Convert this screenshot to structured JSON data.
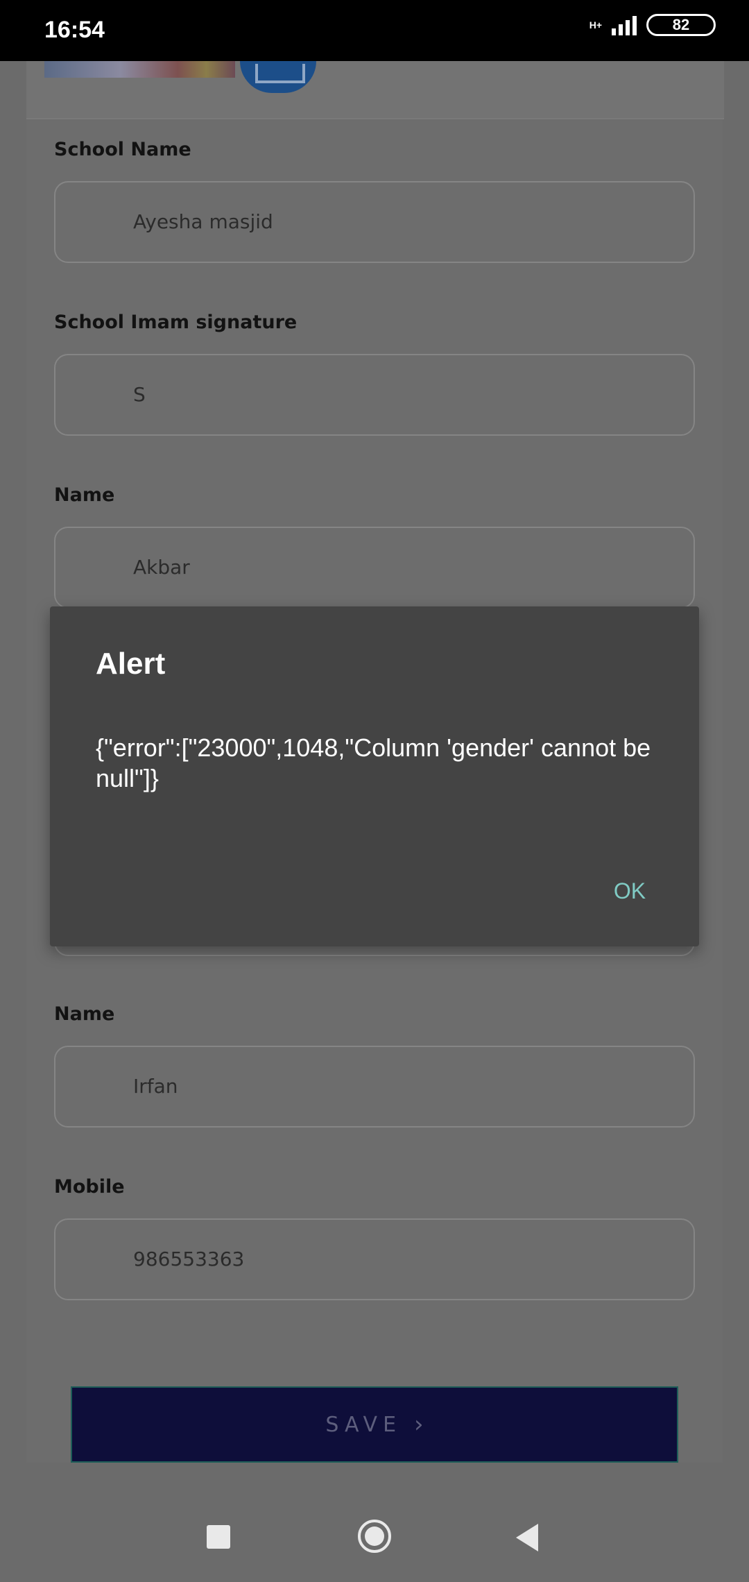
{
  "status_bar": {
    "time": "16:54",
    "network": "H+",
    "battery": "82"
  },
  "form": {
    "fields": [
      {
        "label": "School Name",
        "value": "Ayesha masjid"
      },
      {
        "label": "School Imam signature",
        "value": "S"
      },
      {
        "label": "Name",
        "value": "Akbar"
      },
      {
        "label": "Name",
        "value": "Irfan"
      },
      {
        "label": "Mobile",
        "value": "986553363"
      }
    ],
    "save_label": "SAVE",
    "save_chevron": "›"
  },
  "dialog": {
    "title": "Alert",
    "message": " {\"error\":[\"23000\",1048,\"Column 'gender' cannot be null\"]}",
    "ok_label": "OK"
  },
  "colors": {
    "dialog_background": "#444444",
    "ok_accent": "#80cbc4",
    "save_button": "#0e0e3a"
  },
  "icons": {
    "upload_icon": "image-upload-icon",
    "nav_recents": "square-icon",
    "nav_home": "circle-icon",
    "nav_back": "triangle-back-icon"
  }
}
